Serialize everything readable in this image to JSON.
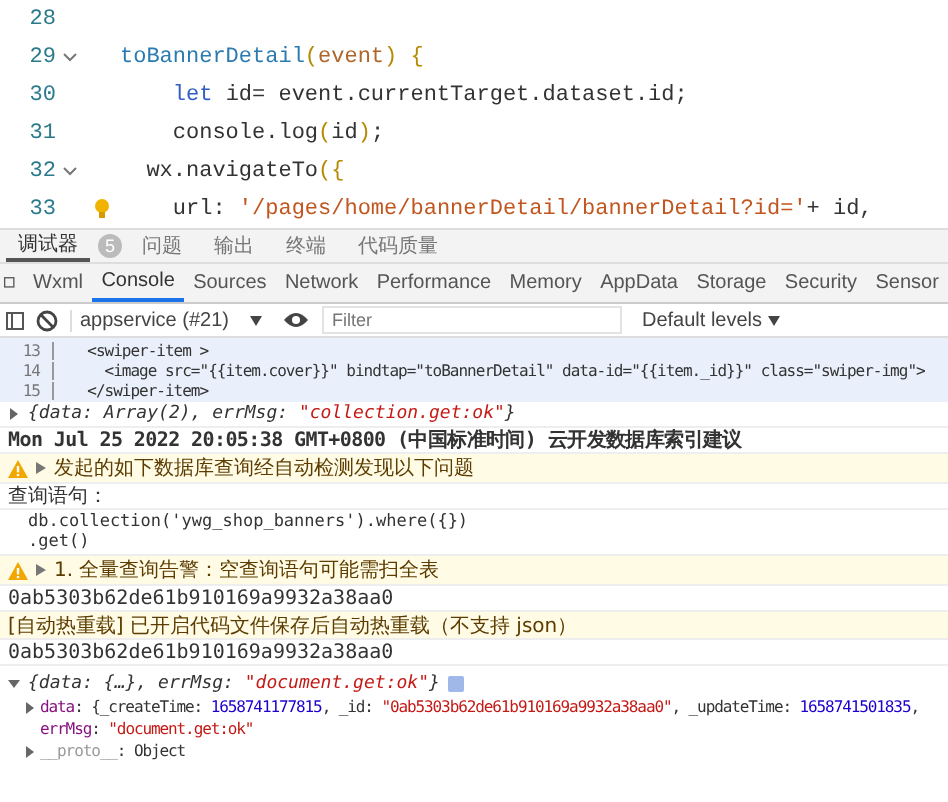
{
  "editor": {
    "lines": [
      {
        "number": "28",
        "fold": false,
        "hint": false
      },
      {
        "number": "29",
        "fold": true,
        "hint": false,
        "tokens": [
          {
            "t": "toBannerDetail",
            "kind": "fn"
          },
          {
            "t": "(",
            "kind": "bracket"
          },
          {
            "t": "event",
            "kind": "param"
          },
          {
            "t": ") {",
            "kind": "bracket"
          }
        ]
      },
      {
        "number": "30",
        "fold": false,
        "hint": false,
        "tokens": [
          {
            "t": "    let",
            "kind": "kw"
          },
          {
            "t": " id= event.currentTarget.dataset.id;",
            "kind": "plain"
          }
        ]
      },
      {
        "number": "31",
        "fold": false,
        "hint": false,
        "tokens": [
          {
            "t": "    console.log",
            "kind": "plain"
          },
          {
            "t": "(",
            "kind": "bracket"
          },
          {
            "t": "id",
            "kind": "plain"
          },
          {
            "t": ")",
            "kind": "bracket"
          },
          {
            "t": ";",
            "kind": "plain"
          }
        ]
      },
      {
        "number": "32",
        "fold": true,
        "hint": false,
        "tokens": [
          {
            "t": "  wx.navigateTo",
            "kind": "plain"
          },
          {
            "t": "({",
            "kind": "bracket"
          }
        ]
      },
      {
        "number": "33",
        "fold": false,
        "hint": true,
        "tokens": [
          {
            "t": "    url: ",
            "kind": "plain"
          },
          {
            "t": "'/pages/home/bannerDetail/bannerDetail?id='",
            "kind": "str"
          },
          {
            "t": "+ id,",
            "kind": "plain"
          }
        ]
      }
    ]
  },
  "panel_tabs": [
    {
      "label": "调试器",
      "selected": true,
      "badge": "5"
    },
    {
      "label": "问题",
      "selected": false
    },
    {
      "label": "输出",
      "selected": false
    },
    {
      "label": "终端",
      "selected": false
    },
    {
      "label": "代码质量",
      "selected": false
    }
  ],
  "devtools_tabs": [
    {
      "label": "Wxml",
      "selected": false
    },
    {
      "label": "Console",
      "selected": true
    },
    {
      "label": "Sources",
      "selected": false
    },
    {
      "label": "Network",
      "selected": false
    },
    {
      "label": "Performance",
      "selected": false
    },
    {
      "label": "Memory",
      "selected": false
    },
    {
      "label": "AppData",
      "selected": false
    },
    {
      "label": "Storage",
      "selected": false
    },
    {
      "label": "Security",
      "selected": false
    },
    {
      "label": "Sensor",
      "selected": false
    }
  ],
  "toolbar": {
    "context": "appservice (#21)",
    "filter": {
      "placeholder": "Filter"
    },
    "levels": "Default levels"
  },
  "console": [
    {
      "kind": "source",
      "lines": [
        {
          "number": "13",
          "text": "  <swiper-item >"
        },
        {
          "number": "14",
          "text": "    <image src=\"{{item.cover}}\" bindtap=\"toBannerDetail\" data-id=\"{{item._id}}\" class=\"swiper-img\">"
        },
        {
          "number": "15",
          "text": "  </swiper-item>"
        }
      ]
    },
    {
      "kind": "object",
      "expanded": false,
      "tokens": [
        {
          "t": "{data: Array(2), errMsg: ",
          "kind": "plain"
        },
        {
          "t": "\"collection.get:ok\"",
          "kind": "str"
        },
        {
          "t": "}",
          "kind": "plain"
        }
      ]
    },
    {
      "kind": "heading",
      "text": "Mon Jul 25 2022 20:05:38 GMT+0800 (中国标准时间) 云开发数据库索引建议"
    },
    {
      "kind": "warn",
      "text": "发起的如下数据库查询经自动检测发现以下问题"
    },
    {
      "kind": "log",
      "text": "查询语句："
    },
    {
      "kind": "code",
      "text": "db.collection('ywg_shop_banners').where({})\n.get()"
    },
    {
      "kind": "warn",
      "text": "1. 全量查询告警：空查询语句可能需扫全表"
    },
    {
      "kind": "log",
      "text": "0ab5303b62de61b910169a9932a38aa0"
    },
    {
      "kind": "notice",
      "text": "[自动热重载] 已开启代码文件保存后自动热重载（不支持 json）"
    },
    {
      "kind": "log",
      "text": "0ab5303b62de61b910169a9932a38aa0"
    },
    {
      "kind": "object",
      "expanded": true,
      "tokens": [
        {
          "t": "{data: {…}, errMsg: ",
          "kind": "plain"
        },
        {
          "t": "\"document.get:ok\"",
          "kind": "str"
        },
        {
          "t": "}",
          "kind": "plain"
        }
      ],
      "children": [
        {
          "expandable": true,
          "tokens": [
            {
              "t": "data",
              "kind": "key"
            },
            {
              "t": ": {_createTime: ",
              "kind": "plain"
            },
            {
              "t": "1658741177815",
              "kind": "num"
            },
            {
              "t": ", _id: ",
              "kind": "plain"
            },
            {
              "t": "\"0ab5303b62de61b910169a9932a38aa0\"",
              "kind": "str"
            },
            {
              "t": ", _updateTime: ",
              "kind": "plain"
            },
            {
              "t": "1658741501835",
              "kind": "num"
            },
            {
              "t": ",",
              "kind": "plain"
            }
          ]
        },
        {
          "expandable": false,
          "tokens": [
            {
              "t": "errMsg",
              "kind": "key"
            },
            {
              "t": ": ",
              "kind": "plain"
            },
            {
              "t": "\"document.get:ok\"",
              "kind": "str"
            }
          ]
        },
        {
          "expandable": true,
          "tokens": [
            {
              "t": "__proto__",
              "kind": "dim"
            },
            {
              "t": ": Object",
              "kind": "plain"
            }
          ]
        }
      ]
    }
  ]
}
